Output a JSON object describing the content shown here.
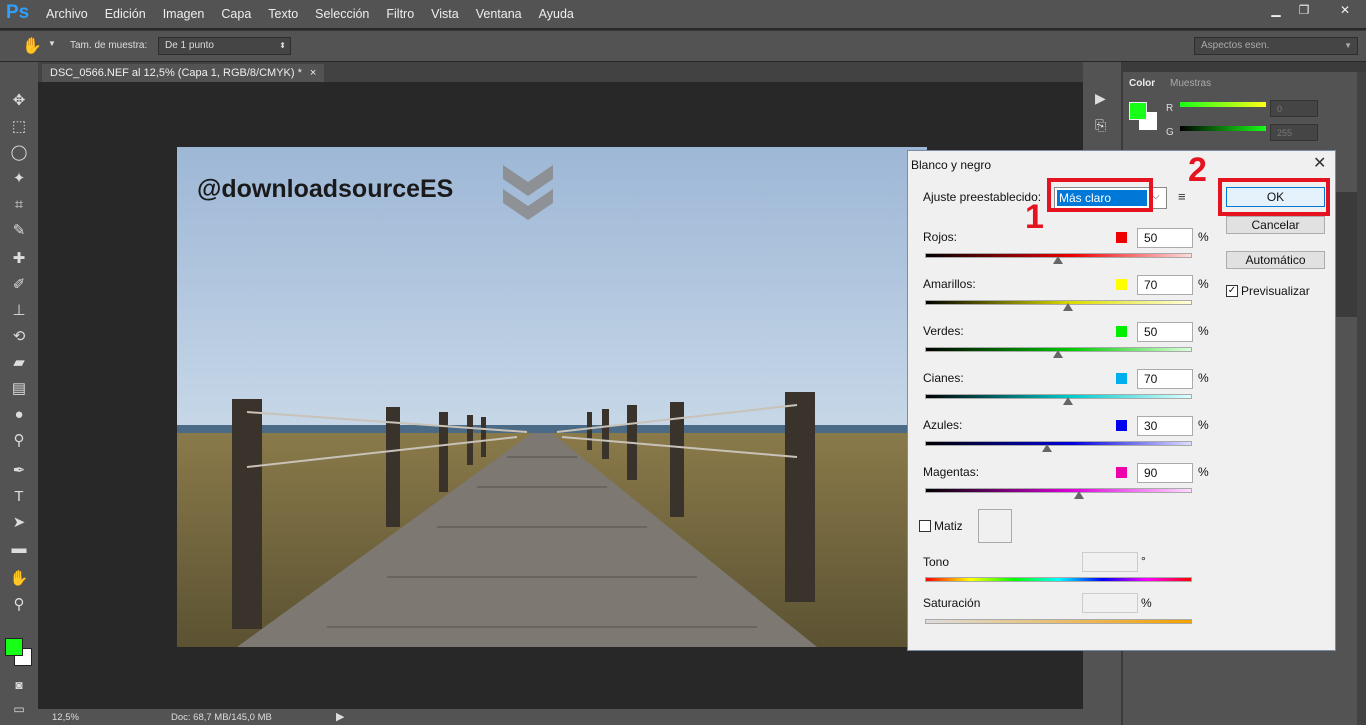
{
  "app": {
    "logo": "Ps",
    "menu": [
      "Archivo",
      "Edición",
      "Imagen",
      "Capa",
      "Texto",
      "Selección",
      "Filtro",
      "Vista",
      "Ventana",
      "Ayuda"
    ]
  },
  "options": {
    "sample_label": "Tam. de muestra:",
    "sample_value": "De 1 punto",
    "workspace": "Aspectos esen."
  },
  "document": {
    "tab_title": "DSC_0566.NEF al 12,5% (Capa 1, RGB/8/CMYK) *",
    "watermark": "@downloadsourceES"
  },
  "status": {
    "zoom": "12,5%",
    "doc": "Doc: 68,7 MB/145,0 MB"
  },
  "panels": {
    "color_tab": "Color",
    "swatches_tab": "Muestras",
    "r_label": "R",
    "g_label": "G",
    "r_value": "0",
    "g_value": "255",
    "fg_color": "#17ff17",
    "bg_color": "#ffffff"
  },
  "dialog": {
    "title": "Blanco y negro",
    "preset_label": "Ajuste preestablecido:",
    "preset_value": "Más claro",
    "ok": "OK",
    "cancel": "Cancelar",
    "auto": "Automático",
    "preview": "Previsualizar",
    "sliders": [
      {
        "label": "Rojos:",
        "value": "50",
        "pct": "%",
        "color": "#ee0000",
        "level": 50
      },
      {
        "label": "Amarillos:",
        "value": "70",
        "pct": "%",
        "color": "#ffff00",
        "level": 70
      },
      {
        "label": "Verdes:",
        "value": "50",
        "pct": "%",
        "color": "#00ee00",
        "level": 50
      },
      {
        "label": "Cianes:",
        "value": "70",
        "pct": "%",
        "color": "#00b0ee",
        "level": 70
      },
      {
        "label": "Azules:",
        "value": "30",
        "pct": "%",
        "color": "#0000ee",
        "level": 30
      },
      {
        "label": "Magentas:",
        "value": "90",
        "pct": "%",
        "color": "#ee00aa",
        "level": 90
      }
    ],
    "tint": "Matiz",
    "hue": "Tono",
    "hue_unit": "°",
    "saturation": "Saturación",
    "sat_unit": "%"
  },
  "annotations": {
    "one": "1",
    "two": "2"
  }
}
